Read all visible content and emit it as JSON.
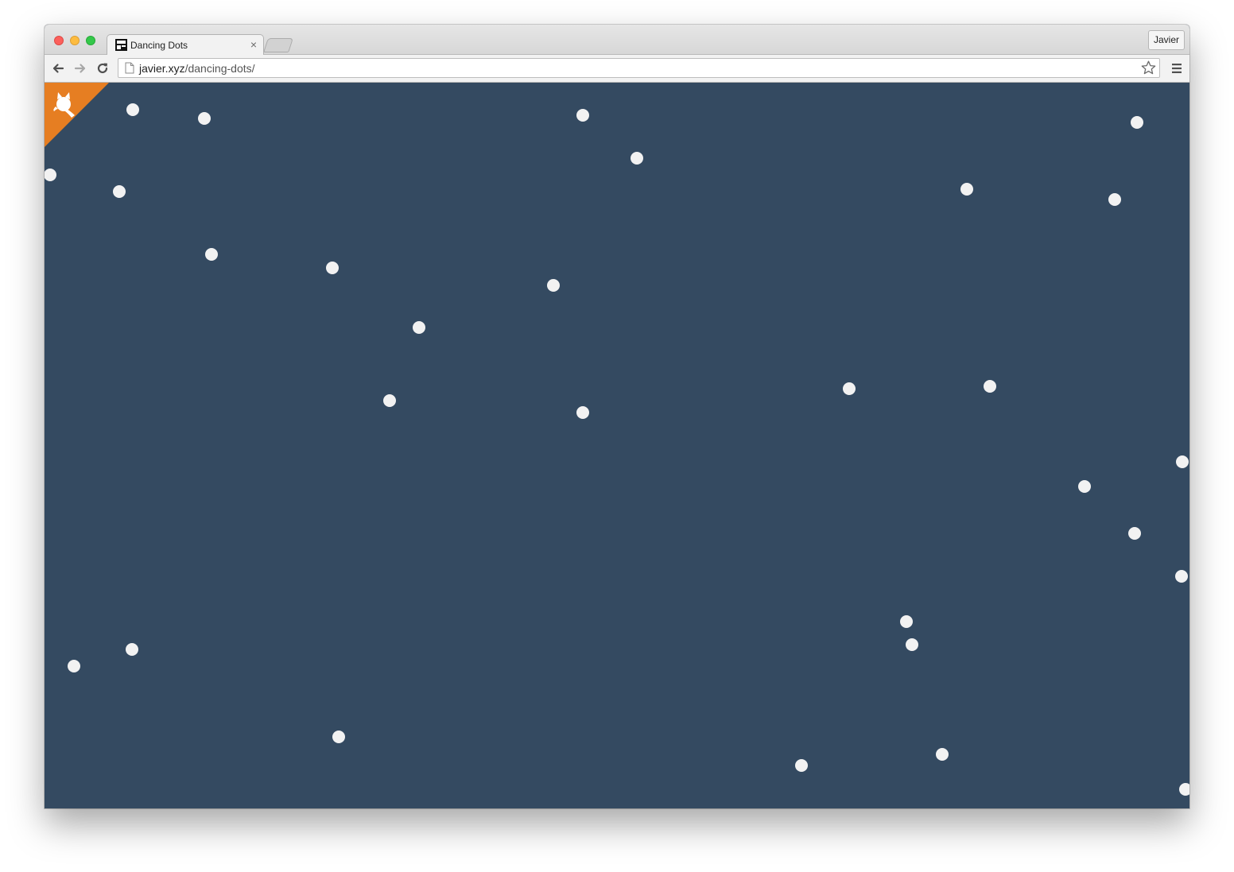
{
  "browser": {
    "tab_title": "Dancing Dots",
    "tab_close": "×",
    "profile_name": "Javier",
    "url_host": "javier.xyz",
    "url_path": "/dancing-dots/"
  },
  "page": {
    "background_color": "#344a61",
    "dot_color": "#f2f2f2",
    "corner_color": "#e67e22"
  },
  "icons": {
    "back": "back-arrow-icon",
    "forward": "forward-arrow-icon",
    "reload": "reload-icon",
    "page": "page-icon",
    "star": "star-icon",
    "menu": "hamburger-menu-icon",
    "corner": "github-octocat-icon"
  }
}
